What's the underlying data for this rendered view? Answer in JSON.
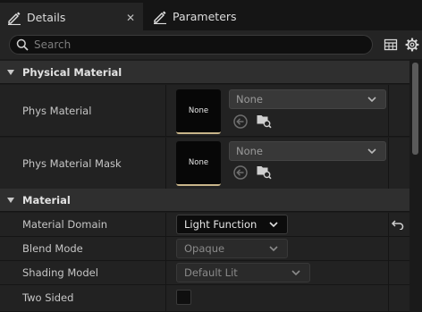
{
  "tabs": [
    {
      "label": "Details",
      "icon": "pencil-icon",
      "active": true
    },
    {
      "label": "Parameters",
      "icon": "pencil-icon",
      "active": false
    }
  ],
  "tab_close": "✕",
  "search": {
    "placeholder": "Search"
  },
  "categories": {
    "physical_material": "Physical Material",
    "material": "Material"
  },
  "physical_material": {
    "phys_material": {
      "label": "Phys Material",
      "thumb_text": "None",
      "value": "None"
    },
    "phys_material_mask": {
      "label": "Phys Material Mask",
      "thumb_text": "None",
      "value": "None"
    }
  },
  "material": {
    "material_domain": {
      "label": "Material Domain",
      "value": "Light Function",
      "enabled": true
    },
    "blend_mode": {
      "label": "Blend Mode",
      "value": "Opaque",
      "enabled": false
    },
    "shading_model": {
      "label": "Shading Model",
      "value": "Default Lit",
      "enabled": false
    },
    "two_sided": {
      "label": "Two Sided",
      "checked": false
    }
  },
  "colors": {
    "accent_gold": "#c8b58a",
    "panel_bg": "#222222",
    "category_bg": "#2f2f2f"
  }
}
